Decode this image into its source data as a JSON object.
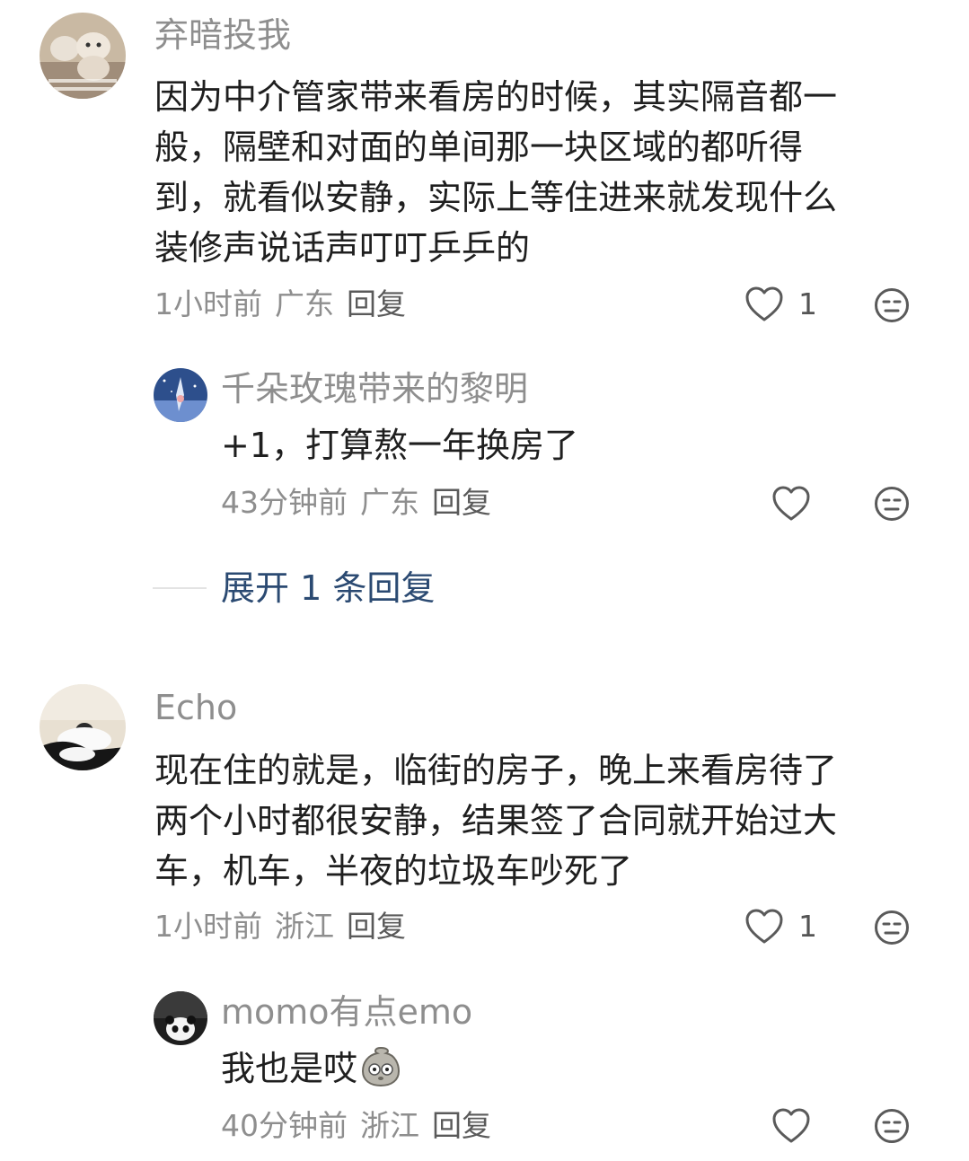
{
  "comments": [
    {
      "user": "弃暗投我",
      "avatar_icon": "plush-doll-avatar",
      "text_lines": [
        "因为中介管家带来看房的时候，其实隔音都一",
        "般，隔壁和对面的单间那一块区域的都听得",
        "到，就看似安静，实际上等住进来就发现什么",
        "装修声说话声叮叮乒乒的"
      ],
      "time": "1小时前",
      "location": "广东",
      "reply_label": "回复",
      "likes": "1",
      "replies": [
        {
          "user": "千朵玫瑰带来的黎明",
          "avatar_icon": "night-sky-avatar",
          "text": "+1，打算熬一年换房了",
          "time": "43分钟前",
          "location": "广东",
          "reply_label": "回复"
        }
      ],
      "expand_label": "展开 1 条回复"
    },
    {
      "user": "Echo",
      "avatar_icon": "person-sleeping-avatar",
      "text_lines": [
        "现在住的就是，临街的房子，晚上来看房待了",
        "两个小时都很安静，结果签了合同就开始过大",
        "车，机车，半夜的垃圾车吵死了"
      ],
      "time": "1小时前",
      "location": "浙江",
      "reply_label": "回复",
      "likes": "1",
      "replies": [
        {
          "user": "momo有点emo",
          "avatar_icon": "panda-avatar",
          "text": "我也是哎",
          "emoji": "speechless-emoji",
          "time": "40分钟前",
          "location": "浙江",
          "reply_label": "回复"
        }
      ]
    }
  ],
  "icons": {
    "like": "heart-outline-icon",
    "dislike": "meh-face-icon"
  },
  "colors": {
    "name": "#8e8e8e",
    "text": "#1f1f1f",
    "link": "#2b4a72",
    "icon": "#5a5a5a"
  }
}
